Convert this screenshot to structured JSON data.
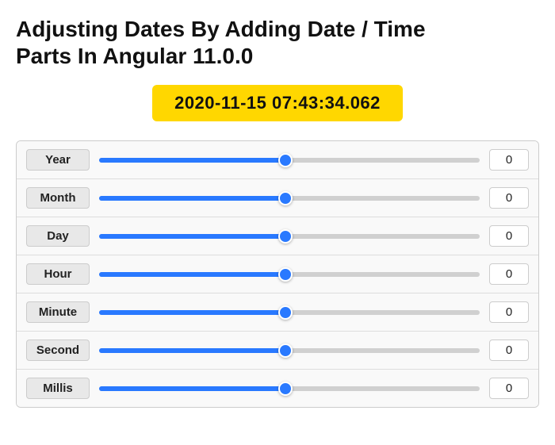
{
  "title": {
    "line1": "Adjusting Dates By Adding Date / Time",
    "line2": "Parts In Angular 11.0.0"
  },
  "dateDisplay": {
    "value": "2020-11-15 07:43:34.062"
  },
  "sliders": [
    {
      "id": "year",
      "label": "Year",
      "value": 0,
      "fill_pct": 49
    },
    {
      "id": "month",
      "label": "Month",
      "value": 0,
      "fill_pct": 49
    },
    {
      "id": "day",
      "label": "Day",
      "value": 0,
      "fill_pct": 49
    },
    {
      "id": "hour",
      "label": "Hour",
      "value": 0,
      "fill_pct": 49
    },
    {
      "id": "minute",
      "label": "Minute",
      "value": 0,
      "fill_pct": 49
    },
    {
      "id": "second",
      "label": "Second",
      "value": 0,
      "fill_pct": 49
    },
    {
      "id": "millis",
      "label": "Millis",
      "value": 0,
      "fill_pct": 49
    }
  ]
}
